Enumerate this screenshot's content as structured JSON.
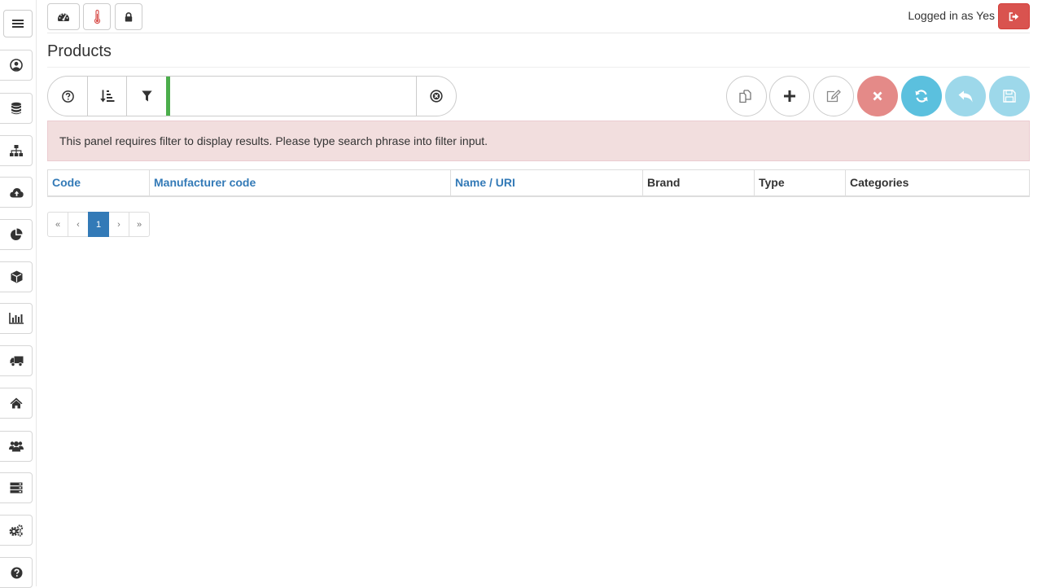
{
  "topbar": {
    "logged_in_text": "Logged in as Yes"
  },
  "page": {
    "title": "Products"
  },
  "filter": {
    "value": "",
    "placeholder": ""
  },
  "alert": {
    "message": "This panel requires filter to display results. Please type search phrase into filter input."
  },
  "table": {
    "columns": [
      "Code",
      "Manufacturer code",
      "Name / URI",
      "Brand",
      "Type",
      "Categories"
    ],
    "rows": []
  },
  "pagination": {
    "first": "«",
    "prev": "‹",
    "current": "1",
    "next": "›",
    "last": "»"
  },
  "colors": {
    "primary": "#337ab7",
    "danger": "#d9534f",
    "info": "#5bc0de",
    "success": "#4cae4c",
    "alert_bg": "#f2dede"
  },
  "icons": {
    "sidebar": [
      "bars-icon",
      "user-circle-icon",
      "database-icon",
      "sitemap-icon",
      "cloud-upload-icon",
      "pie-chart-icon",
      "cube-icon",
      "bar-chart-icon",
      "truck-icon",
      "home-icon",
      "users-icon",
      "server-icon",
      "cogs-icon",
      "question-circle-icon"
    ],
    "topbar": [
      "dashboard-icon",
      "thermometer-icon",
      "lock-icon",
      "sign-out-icon"
    ]
  }
}
